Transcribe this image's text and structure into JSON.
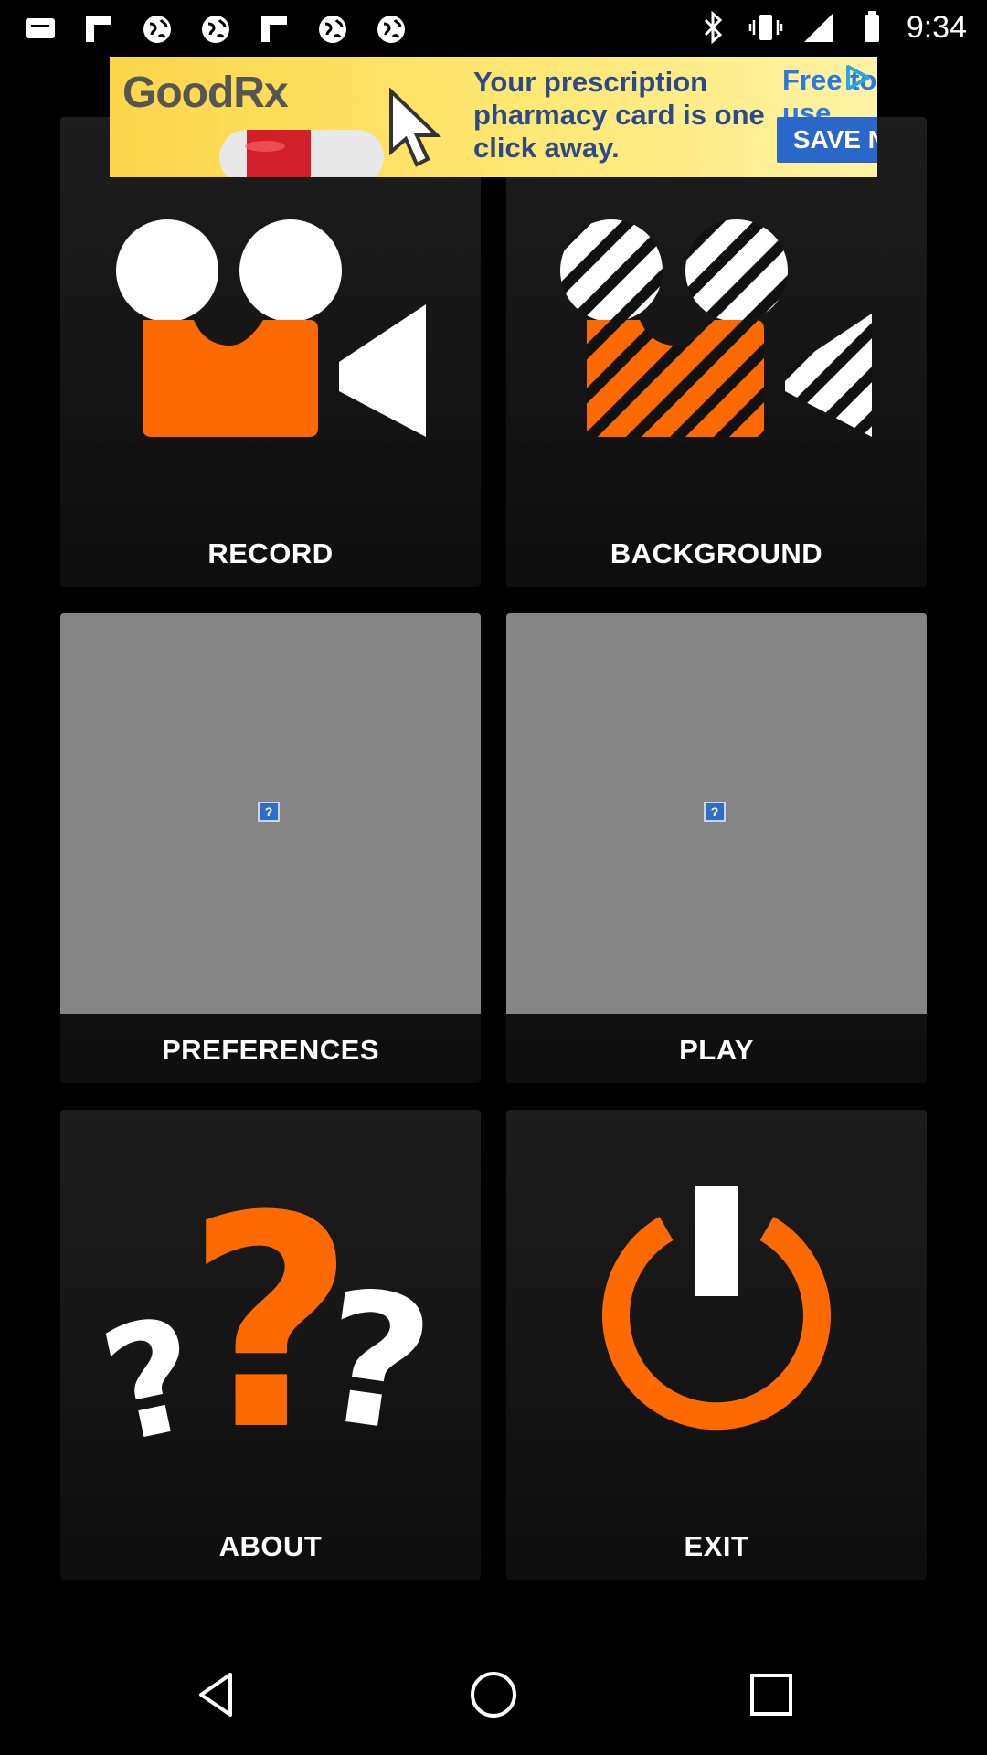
{
  "status_bar": {
    "time": "9:34",
    "left_icons": [
      "message-icon",
      "flipboard-icon",
      "globe-icon",
      "globe-icon",
      "flipboard-icon",
      "globe-icon",
      "globe-icon"
    ],
    "right_icons": [
      "bluetooth-icon",
      "vibrate-icon",
      "signal-icon",
      "battery-icon"
    ]
  },
  "ad": {
    "logo": "GoodRx",
    "headline": "Your prescription pharmacy card is one click away.",
    "free_text": "Free to use",
    "button": "SAVE NOW"
  },
  "tiles": {
    "record": "RECORD",
    "background": "BACKGROUND",
    "preferences": "PREFERENCES",
    "play": "PLAY",
    "about": "ABOUT",
    "exit": "EXIT"
  },
  "colors": {
    "accent": "#ff6a00",
    "tile_bg": "#151515",
    "placeholder": "#858585"
  },
  "nav_bar": {
    "buttons": [
      "back",
      "home",
      "recents"
    ]
  }
}
